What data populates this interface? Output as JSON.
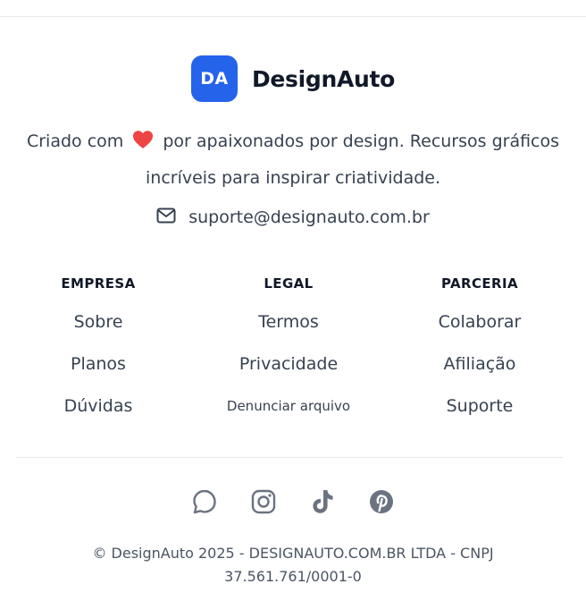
{
  "brand": {
    "logo_text": "DA",
    "name": "DesignAuto",
    "logo_color": "#2563eb"
  },
  "tagline": {
    "before_heart": "Criado com",
    "after_heart": "por apaixonados por design. Recursos gráficos incríveis para inspirar criatividade.",
    "heart_icon": "heart-icon",
    "heart_color": "#ef4444"
  },
  "contact": {
    "icon": "mail-icon",
    "email": "suporte@designauto.com.br"
  },
  "columns": [
    {
      "heading": "EMPRESA",
      "links": [
        "Sobre",
        "Planos",
        "Dúvidas"
      ]
    },
    {
      "heading": "LEGAL",
      "links": [
        "Termos",
        "Privacidade",
        "Denunciar arquivo"
      ]
    },
    {
      "heading": "PARCERIA",
      "links": [
        "Colaborar",
        "Afiliação",
        "Suporte"
      ]
    }
  ],
  "social": [
    "whatsapp-icon",
    "instagram-icon",
    "tiktok-icon",
    "pinterest-icon"
  ],
  "social_color": "#6b7280",
  "copyright": "© DesignAuto 2025 - DESIGNAUTO.COM.BR LTDA - CNPJ 37.561.761/0001-0"
}
